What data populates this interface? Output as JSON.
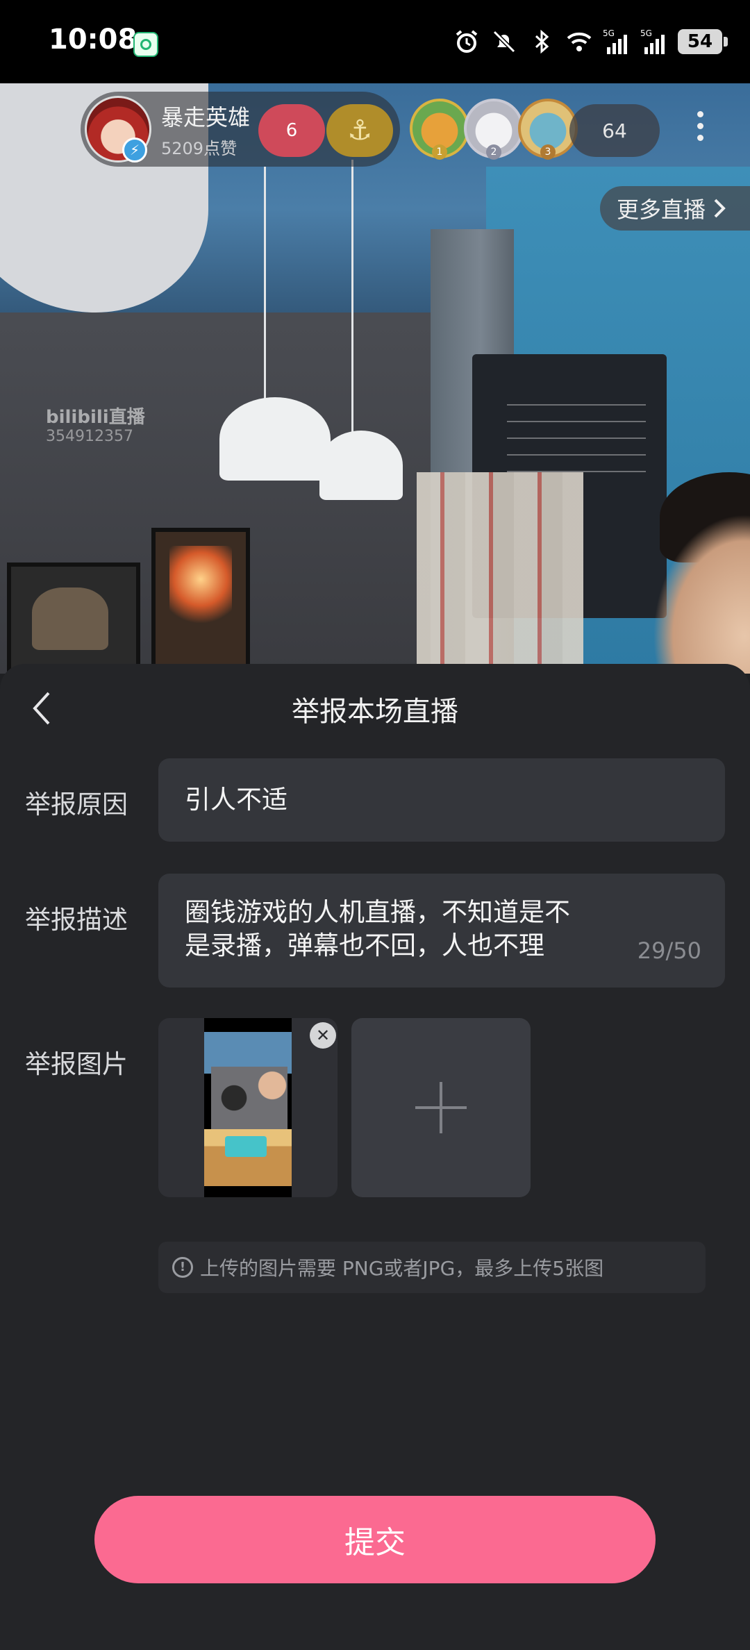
{
  "status_bar": {
    "time": "10:08",
    "battery": "54",
    "network_1": "5G",
    "network_2": "5G"
  },
  "live_room": {
    "host_name": "暴走英雄",
    "host_likes": "5209点赞",
    "heart_count": "6",
    "viewer_count": "64",
    "more_live_label": "更多直播",
    "watermark": "bilibili直播",
    "watermark_id": "354912357",
    "top_fans": [
      {
        "rank": "1",
        "ring_color": "#d9b441"
      },
      {
        "rank": "2",
        "ring_color": "#c9c9d4"
      },
      {
        "rank": "3",
        "ring_color": "#c48a3a"
      }
    ]
  },
  "report": {
    "title": "举报本场直播",
    "reason_label": "举报原因",
    "reason_value": "引人不适",
    "description_label": "举报描述",
    "description_line1": "圈钱游戏的人机直播，不知道是不",
    "description_line2": "是录播，弹幕也不回，人也不理",
    "description_counter": "29/50",
    "image_label": "举报图片",
    "tip": "上传的图片需要 PNG或者JPG，最多上传5张图",
    "submit_label": "提交"
  },
  "colors": {
    "accent_pink": "#fb6a91",
    "sheet_bg": "#242528",
    "field_bg": "#34363b"
  },
  "icons": {
    "back": "chevron-left-icon",
    "close": "close-icon",
    "add": "plus-icon",
    "info": "info-icon",
    "more": "more-vertical-icon"
  }
}
